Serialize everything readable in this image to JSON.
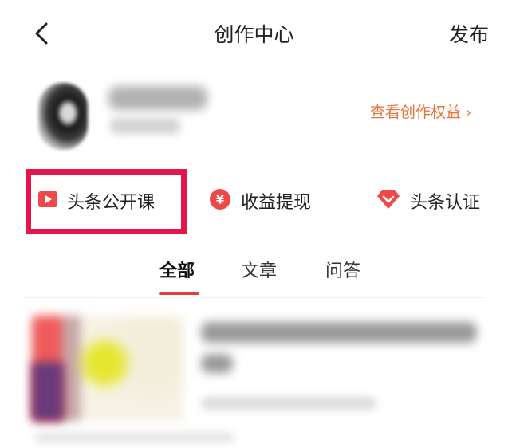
{
  "header": {
    "title": "创作中心",
    "publish_label": "发布"
  },
  "profile": {
    "username": " ",
    "user_id": " ",
    "rights_link": "查看创作权益",
    "rights_chevron": "›"
  },
  "quick_actions": [
    {
      "label": "头条公开课",
      "icon": "play-video-icon",
      "color": "#f04848"
    },
    {
      "label": "收益提现",
      "icon": "yen-coin-icon",
      "color": "#f04848"
    },
    {
      "label": "头条认证",
      "icon": "verified-diamond-icon",
      "color": "#f04848"
    }
  ],
  "highlight_color": "#e4154a",
  "tabs": [
    {
      "label": "全部",
      "active": true
    },
    {
      "label": "文章",
      "active": false
    },
    {
      "label": "问答",
      "active": false
    }
  ],
  "article": {
    "title_line1": " ",
    "title_line2": " ",
    "meta": " ",
    "stats": " "
  },
  "colors": {
    "accent": "#e43b3b",
    "rights_link": "#e8723a"
  }
}
